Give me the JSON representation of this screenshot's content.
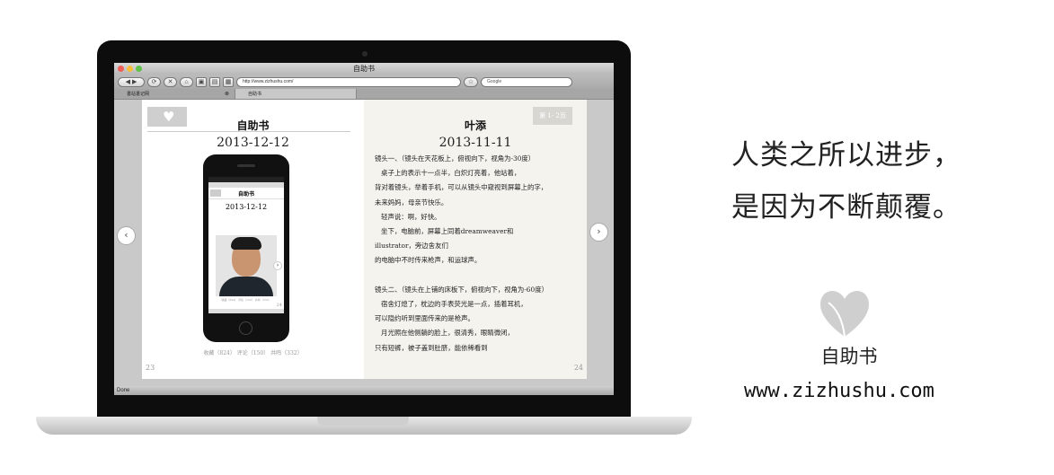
{
  "browser": {
    "window_title": "自助书",
    "url": "http://www.zizhushu.com/",
    "search_placeholder": "Google",
    "tabs": [
      {
        "label": "書站書记网"
      },
      {
        "label": "自助书"
      }
    ],
    "status": "Done"
  },
  "left_page": {
    "title": "自助书",
    "date": "2013-12-12",
    "stats": "收藏（824） 评论（150） 共鸣（332）",
    "page_number": "23",
    "phone": {
      "title": "自助书",
      "date": "2013-12-12",
      "page_number": "24",
      "stats": "收藏（824） 评论（150） 共鸣（332）"
    }
  },
  "right_page": {
    "badge": "第 1- 2页",
    "author": "叶添",
    "date": "2013-11-11",
    "body": "镜头一、（镜头在天花板上，俯视向下，视角为-30度）\n   桌子上的表示十一点半，白炽灯亮着，他站着，\n背对着镜头，举着手机，可以从镜头中窥视到屏幕上的字，\n未来妈妈，母亲节快乐。\n   轻声说：啊，好快。\n   坐下，电脑前，屏幕上同着dreamweaver和\nillustrator，旁边舍友们\n的电脑中不时传来枪声，和运球声。\n\n镜头二、（镜头在上铺的床板下，俯视向下，视角为-60度）\n   宿舍灯熄了，枕边的手表荧光是一点，插着耳机，\n可以隐约听到里面传来的是枪声。\n   月光照在他侧躺的脸上，很清秀，眼睛微闭，\n只有短裤，被子盖到肚脐，能依稀看到",
    "page_number": "24"
  },
  "nav": {
    "prev": "‹",
    "next": "›"
  },
  "slogan": {
    "line1": "人类之所以进步，",
    "line2": "是因为不断颠覆。"
  },
  "brand": {
    "name": "自助书",
    "url": "www.zizhushu.com"
  },
  "colors": {
    "heart": "#cfcfcf",
    "right_page_bg": "#f5f3ee"
  }
}
